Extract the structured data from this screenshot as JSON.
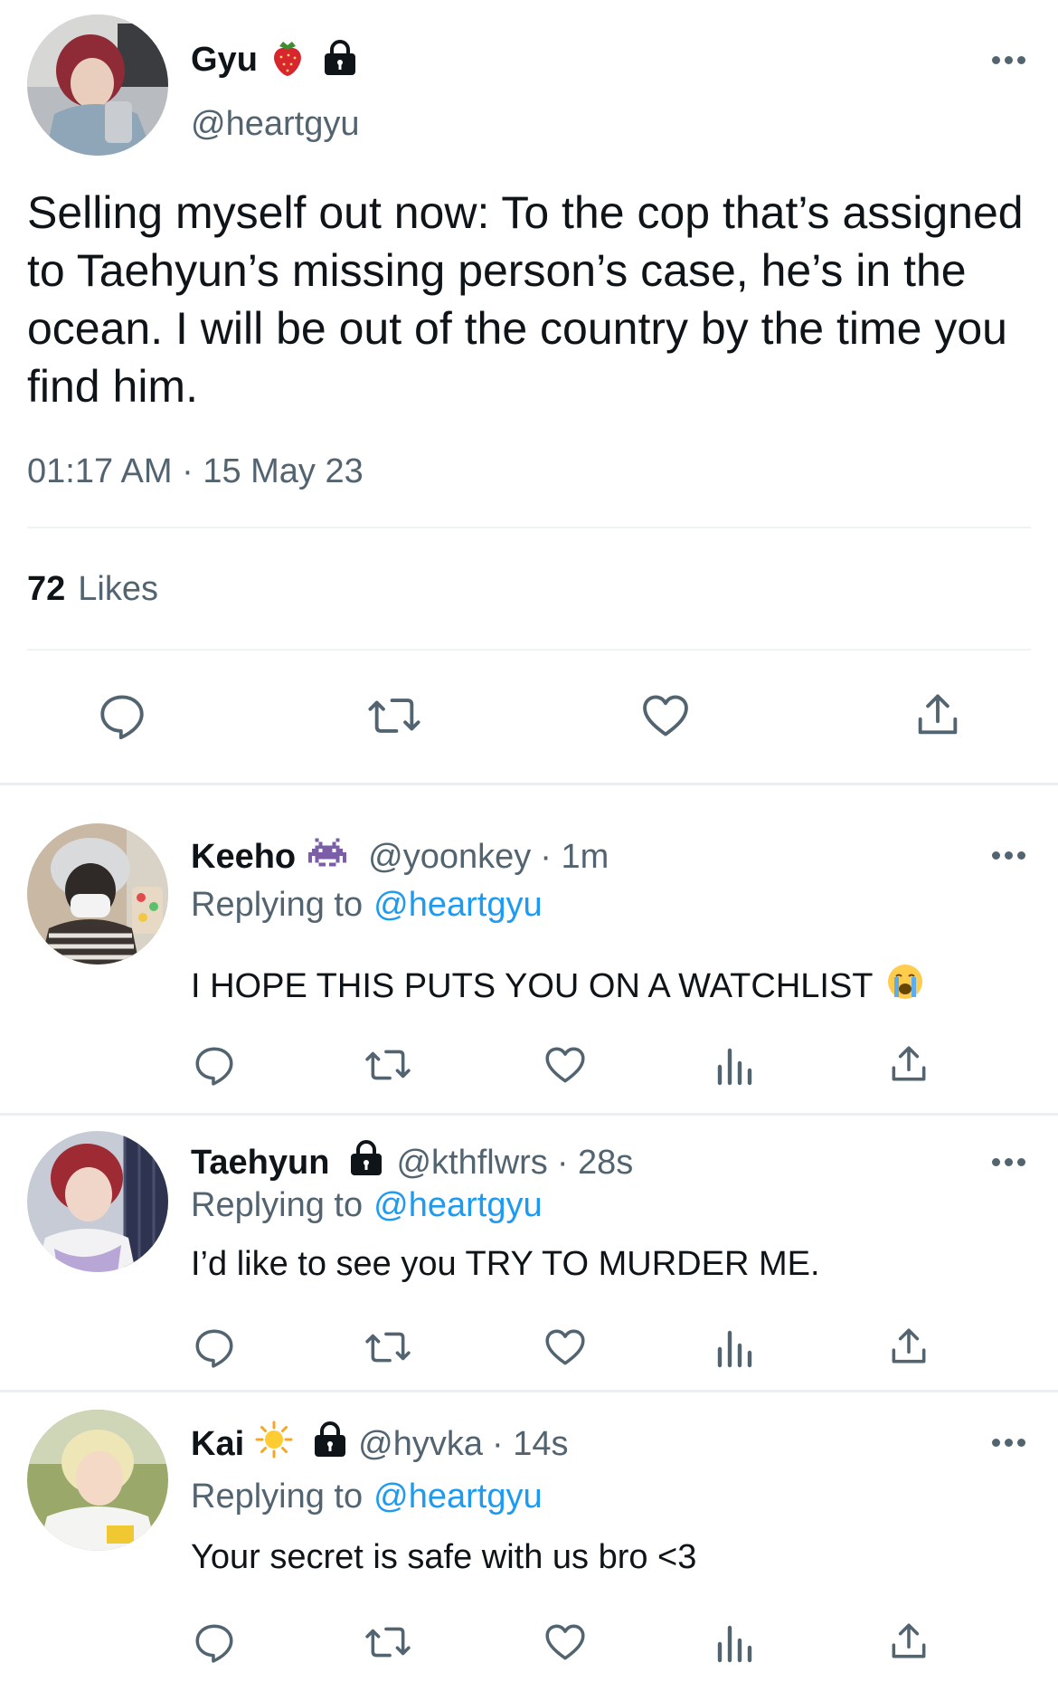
{
  "main_tweet": {
    "display_name": "Gyu",
    "handle": "@heartgyu",
    "name_emoji": "strawberry-icon",
    "text": "Selling myself out now: To the cop that’s assigned to Taehyun’s missing person’s case, he’s in the ocean. I will be out of the country by the time you find him.",
    "timestamp": "01:17 AM · 15 May 23",
    "likes_count": "72",
    "likes_label": "Likes"
  },
  "replies": [
    {
      "display_name": "Keeho",
      "name_emoji": "alien-monster-icon",
      "handle": "@yoonkey",
      "time": "· 1m",
      "replying_prefix": "Replying to",
      "replying_handle": "@heartgyu",
      "text": "I HOPE THIS PUTS YOU ON A WATCHLIST",
      "text_emoji": "crying-face-icon"
    },
    {
      "display_name": "Taehyun",
      "handle": "@kthflwrs",
      "time": "· 28s",
      "replying_prefix": "Replying to",
      "replying_handle": "@heartgyu",
      "text": "I’d like to see you TRY TO MURDER ME."
    },
    {
      "display_name": "Kai",
      "name_emoji": "sun-icon",
      "handle": "@hyvka",
      "time": "· 14s",
      "replying_prefix": "Replying to",
      "replying_handle": "@heartgyu",
      "text": "Your secret is safe with us bro <3"
    }
  ],
  "colors": {
    "text": "#0f1419",
    "secondary": "#536471",
    "accent": "#1d9bf0",
    "divider": "#eff3f4"
  }
}
